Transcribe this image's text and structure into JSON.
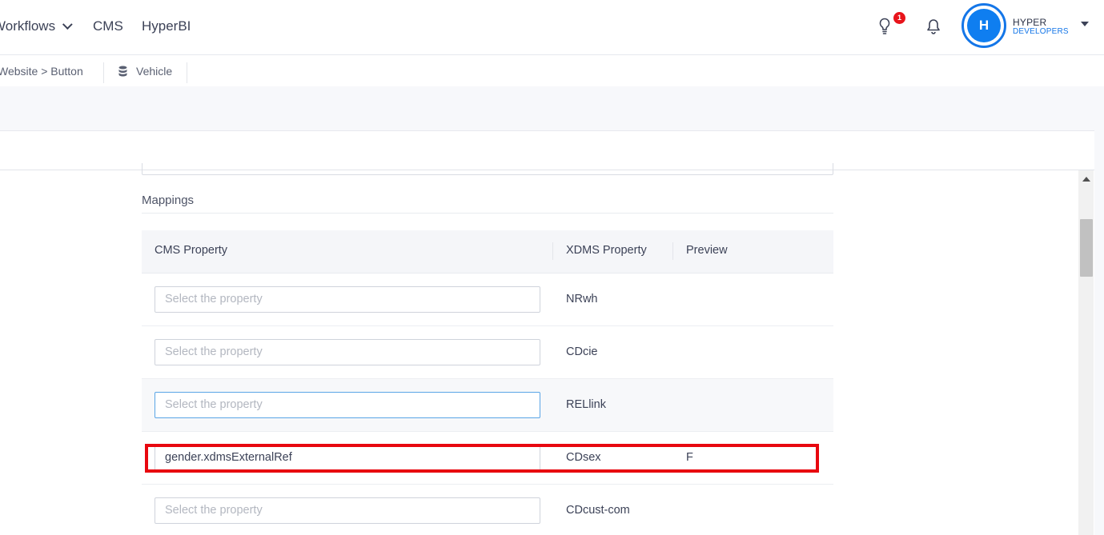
{
  "nav": {
    "workflows": "Workflows",
    "cms": "CMS",
    "hyperbi": "HyperBI",
    "notification_count": "1",
    "user": {
      "initial": "H",
      "name": "HYPER",
      "role": "DEVELOPERS"
    }
  },
  "breadcrumbs": {
    "first": "Website > Button",
    "second": "Vehicle"
  },
  "mappings": {
    "title": "Mappings",
    "headers": {
      "cms": "CMS Property",
      "xdms": "XDMS Property",
      "preview": "Preview"
    },
    "placeholder": "Select the property",
    "rows": [
      {
        "cms": "",
        "xdms": "NRwh",
        "preview": ""
      },
      {
        "cms": "",
        "xdms": "CDcie",
        "preview": ""
      },
      {
        "cms": "",
        "xdms": "RELlink",
        "preview": ""
      },
      {
        "cms": "gender.xdmsExternalRef",
        "xdms": "CDsex",
        "preview": "F"
      },
      {
        "cms": "",
        "xdms": "CDcust-com",
        "preview": ""
      }
    ]
  },
  "colors": {
    "accent": "#1476e8",
    "badge": "#e8141b",
    "highlight": "#e8070f"
  }
}
